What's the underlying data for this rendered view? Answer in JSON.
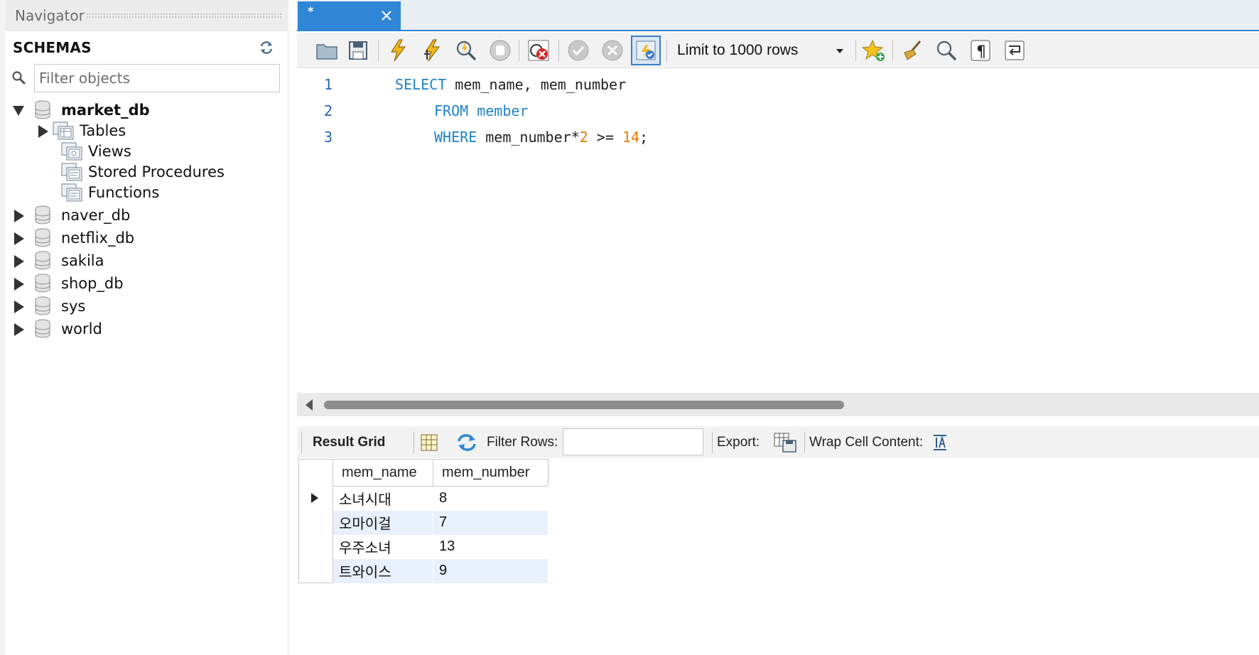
{
  "navigator": {
    "title": "Navigator",
    "schemas_label": "SCHEMAS",
    "filter_placeholder": "Filter objects",
    "tree": [
      {
        "label": "market_db",
        "expanded": true,
        "bold": true
      },
      {
        "label": "Tables",
        "child": true,
        "expandable": true
      },
      {
        "label": "Views",
        "child": true
      },
      {
        "label": "Stored Procedures",
        "child": true
      },
      {
        "label": "Functions",
        "child": true
      },
      {
        "label": "naver_db"
      },
      {
        "label": "netflix_db"
      },
      {
        "label": "sakila"
      },
      {
        "label": "shop_db"
      },
      {
        "label": "sys"
      },
      {
        "label": "world"
      }
    ]
  },
  "editor": {
    "tab_title": "*",
    "limit_select": "Limit to 1000 rows",
    "lines": [
      {
        "no": "1",
        "parts": [
          [
            "kw",
            "SELECT"
          ],
          [
            "id",
            " mem_name, mem_number"
          ]
        ]
      },
      {
        "no": "2",
        "parts": [
          [
            "kw",
            "FROM"
          ],
          [
            "id",
            " "
          ],
          [
            "kw",
            "member"
          ]
        ]
      },
      {
        "no": "3",
        "parts": [
          [
            "kw",
            "WHERE"
          ],
          [
            "id",
            " mem_number*"
          ],
          [
            "num",
            "2"
          ],
          [
            "id",
            " >= "
          ],
          [
            "num",
            "14"
          ],
          [
            "id",
            ";"
          ]
        ]
      }
    ]
  },
  "result_toolbar": {
    "result_grid": "Result Grid",
    "filter_rows": "Filter Rows:",
    "export": "Export:",
    "wrap_cell": "Wrap Cell Content:"
  },
  "grid": {
    "columns": [
      "mem_name",
      "mem_number"
    ],
    "rows": [
      [
        "소녀시대",
        "8"
      ],
      [
        "오마이걸",
        "7"
      ],
      [
        "우주소녀",
        "13"
      ],
      [
        "트와이스",
        "9"
      ]
    ]
  },
  "colors": {
    "accent": "#2f86d6",
    "keyword": "#1f82c9",
    "number": "#e07b00",
    "alt_row": "#e8f0fb"
  }
}
